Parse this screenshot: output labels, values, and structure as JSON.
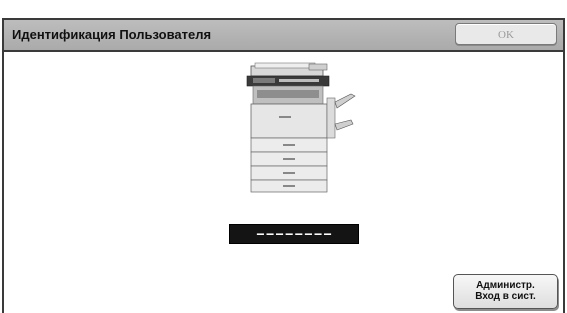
{
  "dialog": {
    "title": "Идентификация Пользователя",
    "ok_label": "OK"
  },
  "main": {
    "device_image": "multifunction-printer-icon",
    "pin_mask": "––––––––"
  },
  "admin_button": {
    "line1": "Администр.",
    "line2": "Вход в сист."
  }
}
